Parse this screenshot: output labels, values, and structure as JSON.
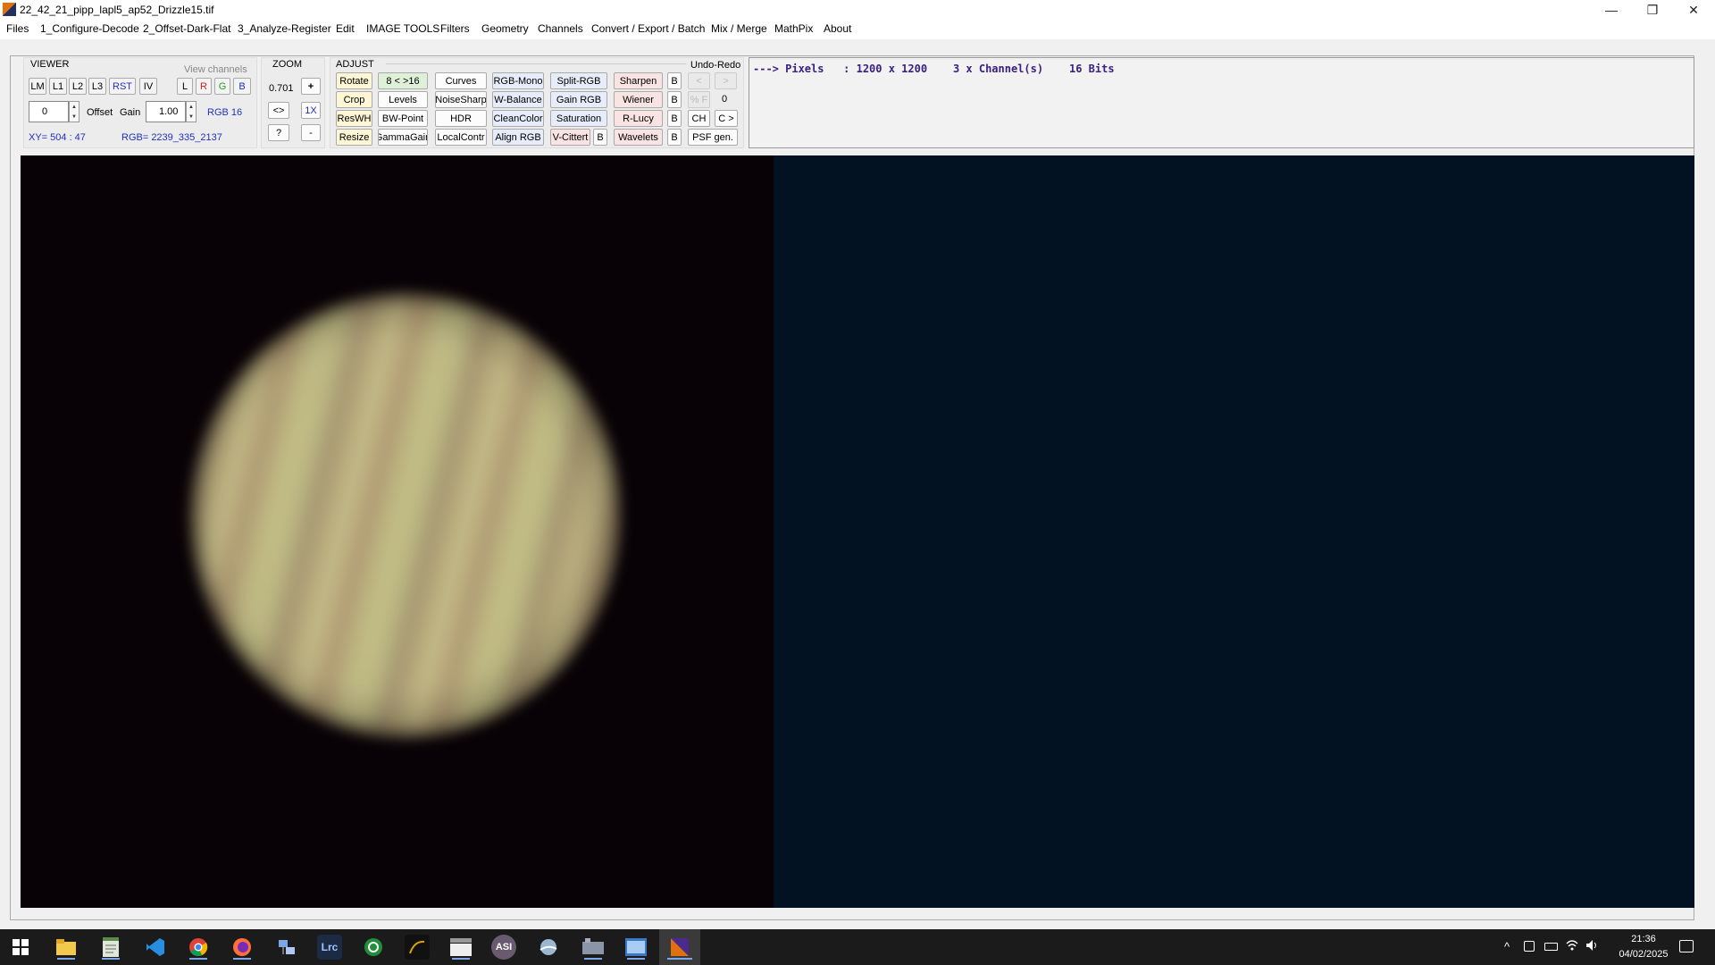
{
  "window": {
    "title": "22_42_21_pipp_lapl5_ap52_Drizzle15.tif",
    "minimize": "—",
    "restore": "❐",
    "close": "✕"
  },
  "menu": [
    "Files",
    "1_Configure-Decode",
    "2_Offset-Dark-Flat",
    "3_Analyze-Register",
    "Edit",
    "IMAGE TOOLS",
    "Filters",
    "Geometry",
    "Channels",
    "Convert / Export / Batch",
    "Mix / Merge",
    "MathPix",
    "About"
  ],
  "viewer": {
    "label": "VIEWER",
    "view_channels_label": "View channels",
    "buttons": [
      "LM",
      "L1",
      "L2",
      "L3",
      "RST",
      "IV"
    ],
    "channels": [
      "L",
      "R",
      "G",
      "B"
    ],
    "offset_value": "0",
    "offset_label": "Offset",
    "gain_label": "Gain",
    "gain_value": "1.00",
    "rgb_mode": "RGB 16",
    "xy_readout": "XY=  504 : 47",
    "rgb_readout": "RGB=  2239_335_2137"
  },
  "zoom": {
    "label": "ZOOM",
    "value": "0.701",
    "plus": "+",
    "fit": "<>",
    "one_x": "1X",
    "help": "?",
    "minus": "-"
  },
  "adjust": {
    "label": "ADJUST",
    "undo_redo_label": "Undo-Redo",
    "rows": [
      [
        "Rotate",
        "8 < >16",
        "Curves",
        "RGB-Mono",
        "Split-RGB",
        "Sharpen",
        "B"
      ],
      [
        "Crop",
        "Levels",
        "NoiseSharp",
        "W-Balance",
        "Gain RGB",
        "Wiener",
        "B"
      ],
      [
        "ResWH",
        "BW-Point",
        "HDR",
        "CleanColor",
        "Saturation",
        "R-Lucy",
        "B"
      ],
      [
        "Resize",
        "GammaGain",
        "LocalContr",
        "Align RGB",
        "V-Cittert",
        "B",
        "Wavelets",
        "B",
        "PSF gen."
      ]
    ],
    "undo": "<",
    "redo": ">",
    "percent_f": "% F",
    "undo_count": "0",
    "ch": "CH",
    "c_next": "C >"
  },
  "info": {
    "line": "---> Pixels   : 1200 x 1200    3 x Channel(s)    16 Bits"
  },
  "taskbar": {
    "icons": [
      "windows-start-icon",
      "file-explorer-icon",
      "notepad-icon",
      "vscode-icon",
      "chrome-icon",
      "firefox-icon",
      "network-app-icon",
      "lightroom-classic-icon",
      "green-circle-app-icon",
      "dark-app-icon",
      "clapper-app-icon",
      "asi-studio-icon",
      "stellarium-icon",
      "film-app-icon",
      "photo-viewer-icon",
      "astro-imaging-icon"
    ],
    "lrc_label": "Lrc",
    "asi_label": "ASI",
    "time": "21:36",
    "date": "04/02/2025",
    "tray_chevron": "^"
  },
  "colors": {
    "accent": "#2030c0",
    "info_text": "#3a2080",
    "image_bg_right": "#021223",
    "image_bg_left": "#080206"
  }
}
